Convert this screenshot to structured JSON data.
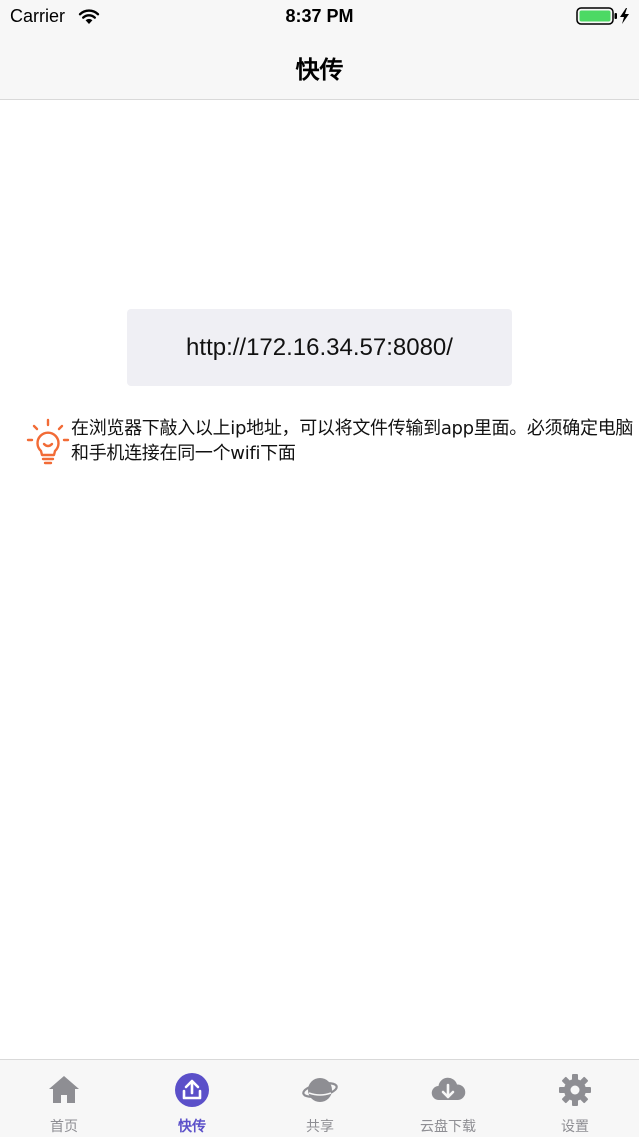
{
  "status_bar": {
    "carrier": "Carrier",
    "time": "8:37 PM",
    "wifi_icon": "wifi-icon",
    "battery_icon": "battery-charging-icon",
    "battery_color": "#4cd964"
  },
  "nav": {
    "title": "快传"
  },
  "main": {
    "url": "http://172.16.34.57:8080/",
    "hint_icon": "lightbulb-icon",
    "hint_icon_color": "#f26b36",
    "hint_text": "在浏览器下敲入以上ip地址，可以将文件传输到app里面。必须确定电脑和手机连接在同一个wifi下面"
  },
  "tab_bar": {
    "active_color": "#5b50c9",
    "inactive_color": "#8e8e93",
    "items": [
      {
        "label": "首页",
        "icon": "home-icon",
        "active": false
      },
      {
        "label": "快传",
        "icon": "upload-icon",
        "active": true
      },
      {
        "label": "共享",
        "icon": "planet-icon",
        "active": false
      },
      {
        "label": "云盘下载",
        "icon": "cloud-download-icon",
        "active": false
      },
      {
        "label": "设置",
        "icon": "gear-icon",
        "active": false
      }
    ]
  }
}
